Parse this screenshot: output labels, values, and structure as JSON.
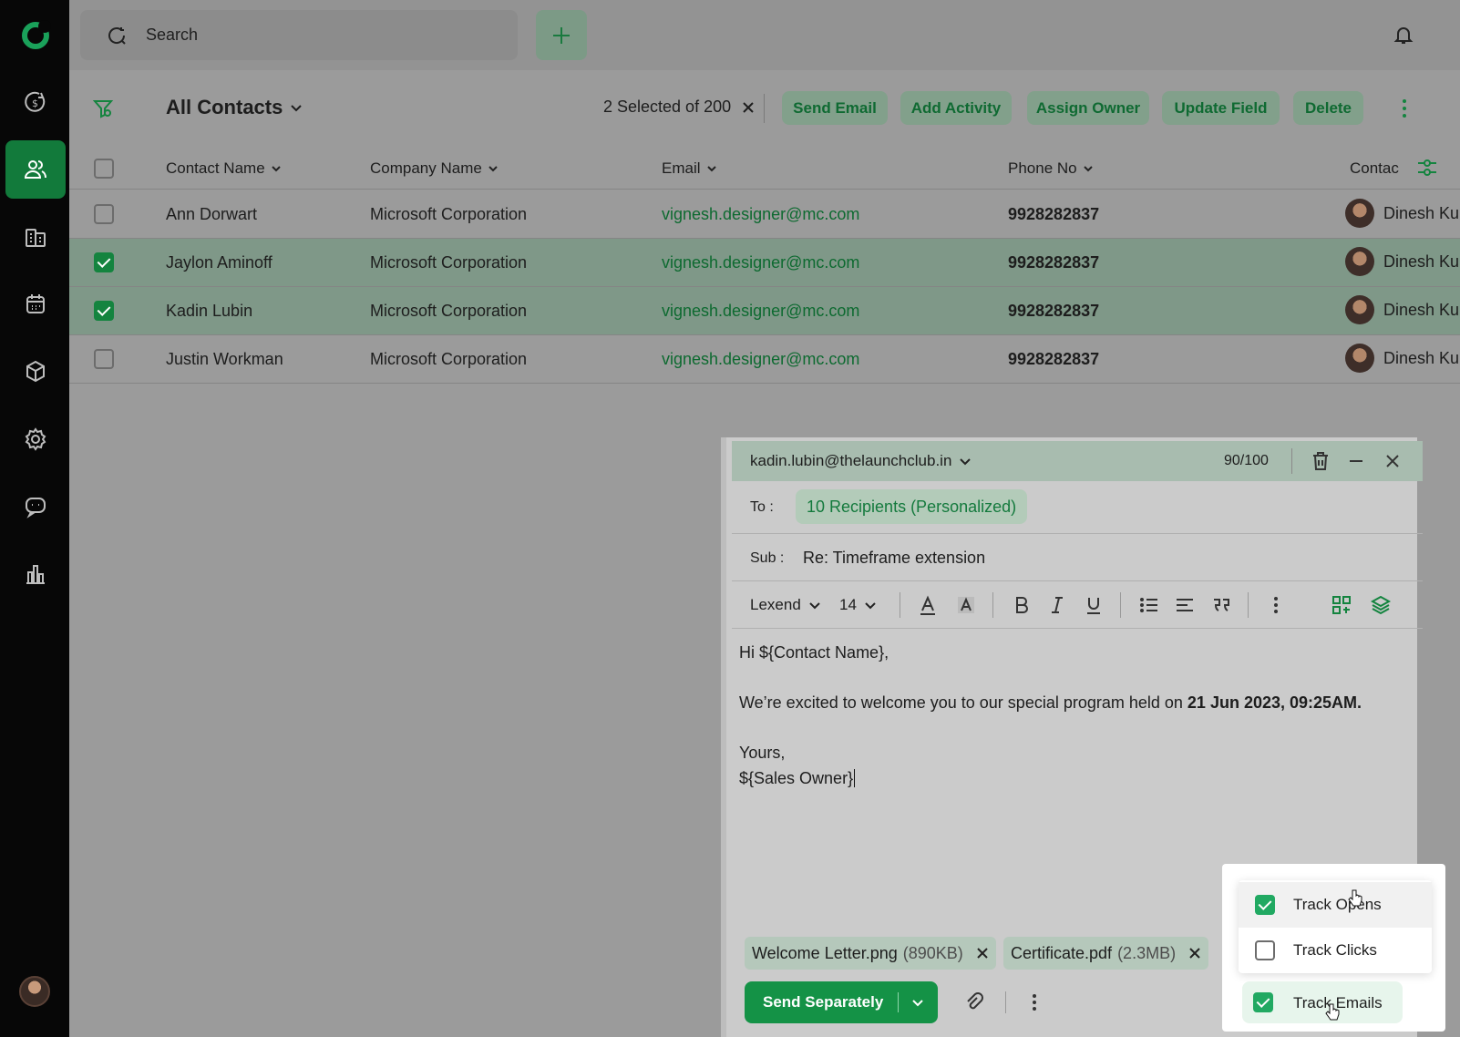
{
  "search": {
    "placeholder": "Search"
  },
  "header": {
    "view_title": "All Contacts",
    "selection": "2 Selected of 200",
    "actions": [
      "Send Email",
      "Add Activity",
      "Assign Owner",
      "Update Field",
      "Delete"
    ]
  },
  "table": {
    "columns": [
      "Contact Name",
      "Company Name",
      "Email",
      "Phone No",
      "Contac"
    ],
    "rows": [
      {
        "name": "Ann Dorwart",
        "company": "Microsoft Corporation",
        "email": "vignesh.designer@mc.com",
        "phone": "9928282837",
        "owner": "Dinesh Ku",
        "selected": false
      },
      {
        "name": "Jaylon Aminoff",
        "company": "Microsoft Corporation",
        "email": "vignesh.designer@mc.com",
        "phone": "9928282837",
        "owner": "Dinesh Ku",
        "selected": true
      },
      {
        "name": "Kadin Lubin",
        "company": "Microsoft Corporation",
        "email": "vignesh.designer@mc.com",
        "phone": "9928282837",
        "owner": "Dinesh Ku",
        "selected": true
      },
      {
        "name": "Justin Workman",
        "company": "Microsoft Corporation",
        "email": "vignesh.designer@mc.com",
        "phone": "9928282837",
        "owner": "Dinesh Ku",
        "selected": false
      }
    ]
  },
  "composer": {
    "from": "kadin.lubin@thelaunchclub.in",
    "counter": "90/100",
    "to_label": "To :",
    "recipients": "10 Recipients (Personalized)",
    "sub_label": "Sub :",
    "subject": "Re: Timeframe extension",
    "font": "Lexend",
    "font_size": "14",
    "body": {
      "greeting": "Hi ${Contact Name},",
      "line_prefix": "We’re excited to welcome you to our special program held on ",
      "line_date": "21 Jun 2023, 09:25AM.",
      "closing": "Yours,",
      "signature": "${Sales Owner}"
    },
    "attachments": [
      {
        "name": "Welcome Letter.png",
        "size": "(890KB)"
      },
      {
        "name": "Certificate.pdf",
        "size": "(2.3MB)"
      }
    ],
    "send_label": "Send Separately"
  },
  "tracking": {
    "items": [
      {
        "label": "Track Opens",
        "checked": true
      },
      {
        "label": "Track Clicks",
        "checked": false
      }
    ],
    "track_emails": {
      "label": "Track Emails",
      "checked": true
    }
  },
  "colors": {
    "brand_green": "#149246",
    "sidebar_bg": "#070707",
    "selected_row": "#7f9888"
  }
}
